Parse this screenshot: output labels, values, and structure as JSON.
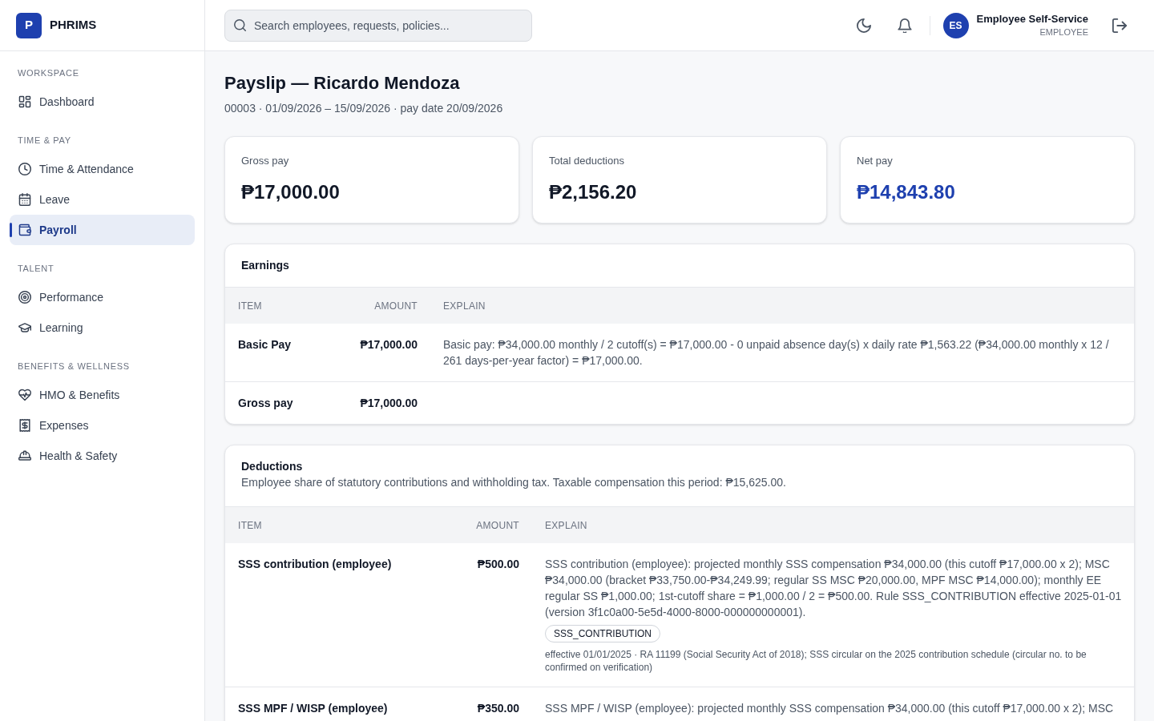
{
  "sidebar": {
    "brand": {
      "logo_letter": "P",
      "name": "PHRIMS"
    },
    "sections": [
      {
        "label": "WORKSPACE",
        "items": [
          {
            "label": "Dashboard",
            "selected": false
          }
        ]
      },
      {
        "label": "TIME & PAY",
        "items": [
          {
            "label": "Time & Attendance",
            "selected": false
          },
          {
            "label": "Leave",
            "selected": false
          },
          {
            "label": "Payroll",
            "selected": true
          }
        ]
      },
      {
        "label": "TALENT",
        "items": [
          {
            "label": "Performance",
            "selected": false
          },
          {
            "label": "Learning",
            "selected": false
          }
        ]
      },
      {
        "label": "BENEFITS & WELLNESS",
        "items": [
          {
            "label": "HMO & Benefits",
            "selected": false
          },
          {
            "label": "Expenses",
            "selected": false
          },
          {
            "label": "Health & Safety",
            "selected": false
          }
        ]
      }
    ]
  },
  "header": {
    "search": {
      "placeholder": "Search employees, requests, policies..."
    },
    "user": {
      "initials": "ES",
      "name": "Employee Self-Service",
      "role": "EMPLOYEE"
    }
  },
  "page": {
    "title": "Payslip — Ricardo Mendoza",
    "subtitle": "00003 · 01/09/2026 – 15/09/2026 · pay date 20/09/2026"
  },
  "summary_cards": [
    {
      "label": "Gross pay",
      "value": "₱17,000.00",
      "emphasis": false
    },
    {
      "label": "Total deductions",
      "value": "₱2,156.20",
      "emphasis": false
    },
    {
      "label": "Net pay",
      "value": "₱14,843.80",
      "emphasis": true
    }
  ],
  "earnings": {
    "title": "Earnings",
    "columns": [
      "ITEM",
      "AMOUNT",
      "EXPLAIN"
    ],
    "rows": [
      {
        "item": "Basic Pay",
        "amount": "₱17,000.00",
        "explain": "Basic pay: ₱34,000.00 monthly / 2 cutoff(s) = ₱17,000.00 - 0 unpaid absence day(s) x daily rate ₱1,563.22 (₱34,000.00 monthly x 12 / 261 days-per-year factor) = ₱17,000.00."
      },
      {
        "item": "Gross pay",
        "amount": "₱17,000.00"
      }
    ]
  },
  "deductions": {
    "title": "Deductions",
    "description": "Employee share of statutory contributions and withholding tax. Taxable compensation this period: ₱15,625.00.",
    "columns": [
      "ITEM",
      "AMOUNT",
      "EXPLAIN"
    ],
    "rows": [
      {
        "item": "SSS contribution (employee)",
        "amount": "₱500.00",
        "explain": "SSS contribution (employee): projected monthly SSS compensation ₱34,000.00 (this cutoff ₱17,000.00 x 2); MSC ₱34,000.00 (bracket ₱33,750.00-₱34,249.99; regular SS MSC ₱20,000.00, MPF MSC ₱14,000.00); monthly EE regular SS ₱1,000.00; 1st-cutoff share = ₱1,000.00 / 2 = ₱500.00. Rule SSS_CONTRIBUTION effective 2025-01-01 (version 3f1c0a00-5e5d-4000-8000-000000000001).",
        "rule_code": "SSS_CONTRIBUTION",
        "legal_basis": "effective 01/01/2025 · RA 11199 (Social Security Act of 2018); SSS circular on the 2025 contribution schedule (circular no. to be confirmed on verification)"
      },
      {
        "item": "SSS MPF / WISP (employee)",
        "amount": "₱350.00",
        "explain": "SSS MPF / WISP (employee): projected monthly SSS compensation ₱34,000.00 (this cutoff ₱17,000.00 x 2); MSC"
      }
    ]
  }
}
